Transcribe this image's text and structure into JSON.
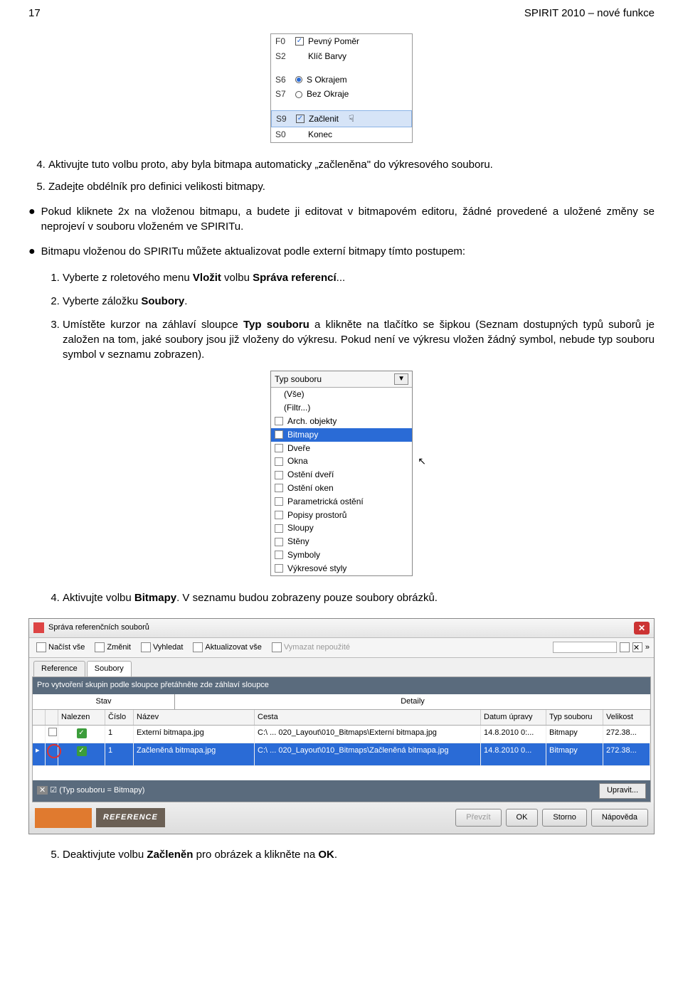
{
  "header": {
    "page_number": "17",
    "doc_title": "SPIRIT 2010 – nové funkce"
  },
  "panel": {
    "rows": [
      {
        "code": "F0",
        "checkbox": true,
        "checked": true,
        "label": "Pevný Poměr"
      },
      {
        "code": "S2",
        "checkbox": false,
        "label": "Klíč Barvy"
      },
      {
        "code": "",
        "checkbox": false,
        "label": ""
      },
      {
        "code": "S6",
        "radio": true,
        "checked": true,
        "label": "S Okrajem"
      },
      {
        "code": "S7",
        "radio": true,
        "checked": false,
        "label": "Bez Okraje"
      },
      {
        "code": "",
        "checkbox": false,
        "label": ""
      },
      {
        "code": "S9",
        "checkbox": true,
        "checked": true,
        "label": "Začlenit",
        "highlight": true,
        "cursor": true
      },
      {
        "code": "S0",
        "checkbox": false,
        "label": "Konec"
      }
    ]
  },
  "step4": "Aktivujte tuto volbu proto, aby byla bitmapa automaticky „začleněna\" do výkresového souboru.",
  "step5": "Zadejte obdélník pro definici velikosti bitmapy.",
  "bullet_a": "Pokud kliknete 2x na vloženou bitmapu, a budete ji editovat v bitmapovém editoru, žádné provedené a uložené změny se neprojeví v souboru vloženém ve SPIRITu.",
  "bullet_b_intro": "Bitmapu vloženou do SPIRITu můžete aktualizovat podle externí bitmapy tímto postupem:",
  "sub1_a": "Vyberte z roletového menu ",
  "sub1_b": "Vložit",
  "sub1_c": " volbu ",
  "sub1_d": "Správa referencí",
  "sub1_e": "...",
  "sub2_a": "Vyberte záložku ",
  "sub2_b": "Soubory",
  "sub2_c": ".",
  "sub3_a": "Umístěte kurzor na záhlaví sloupce ",
  "sub3_b": "Typ souboru",
  "sub3_c": " a klikněte na tlačítko se šipkou (Seznam dostupných typů suborů je založen na tom, jaké soubory jsou již vloženy do výkresu. Pokud není ve výkresu vložen žádný symbol, nebude typ souboru symbol v seznamu zobrazen).",
  "dropdown": {
    "header": "Typ souboru",
    "items": [
      {
        "label": "(Vše)",
        "indent": true,
        "check": false
      },
      {
        "label": "(Filtr...)",
        "indent": true,
        "check": false
      },
      {
        "label": "Arch. objekty",
        "check": true
      },
      {
        "label": "Bitmapy",
        "check": true,
        "selected": true
      },
      {
        "label": "Dveře",
        "check": true
      },
      {
        "label": "Okna",
        "check": true
      },
      {
        "label": "Ostění dveří",
        "check": true
      },
      {
        "label": "Ostění oken",
        "check": true
      },
      {
        "label": "Parametrická ostění",
        "check": true
      },
      {
        "label": "Popisy prostorů",
        "check": true
      },
      {
        "label": "Sloupy",
        "check": true
      },
      {
        "label": "Stěny",
        "check": true
      },
      {
        "label": "Symboly",
        "check": true
      },
      {
        "label": "Výkresové styly",
        "check": true
      }
    ]
  },
  "sub4_a": "Aktivujte volbu ",
  "sub4_b": "Bitmapy",
  "sub4_c": ". V seznamu budou zobrazeny pouze soubory obrázků.",
  "refmgr": {
    "title": "Správa referenčních souborů",
    "toolbar": {
      "nacist": "Načíst vše",
      "zmenit": "Změnit",
      "vyhledat": "Vyhledat",
      "aktualizovat": "Aktualizovat vše",
      "vymazat": "Vymazat nepoužité"
    },
    "tabs": {
      "reference": "Reference",
      "soubory": "Soubory"
    },
    "grouptext": "Pro vytvoření skupin podle sloupce přetáhněte zde záhlaví sloupce",
    "topcols": {
      "stav": "Stav",
      "detaily": "Detaily"
    },
    "cols": {
      "nalezen": "Nalezen",
      "cislo": "Číslo",
      "nazev": "Název",
      "cesta": "Cesta",
      "datum": "Datum úpravy",
      "typ": "Typ souboru",
      "velikost": "Velikost"
    },
    "rows": [
      {
        "nalezen": "✓",
        "cislo": "1",
        "nazev": "Externí bitmapa.jpg",
        "cesta": "C:\\ ... 020_Layout\\010_Bitmaps\\Externí bitmapa.jpg",
        "datum": "14.8.2010 0:...",
        "typ": "Bitmapy",
        "vel": "272.38...",
        "selected": false,
        "circle": false
      },
      {
        "nalezen": "✓",
        "cislo": "1",
        "nazev": "Začleněná bitmapa.jpg",
        "cesta": "C:\\ ... 020_Layout\\010_Bitmaps\\Začleněná bitmapa.jpg",
        "datum": "14.8.2010 0...",
        "typ": "Bitmapy",
        "vel": "272.38...",
        "selected": true,
        "circle": true
      }
    ],
    "filter": "(Typ souboru = Bitmapy)",
    "upravit": "Upravit...",
    "footer_label": "REFERENCE",
    "buttons": {
      "prevzit": "Převzít",
      "ok": "OK",
      "storno": "Storno",
      "napoveda": "Nápověda"
    }
  },
  "sub5_a": "Deaktivjute volbu ",
  "sub5_b": "Začleněn",
  "sub5_c": " pro obrázek a klikněte na ",
  "sub5_d": "OK",
  "sub5_e": "."
}
